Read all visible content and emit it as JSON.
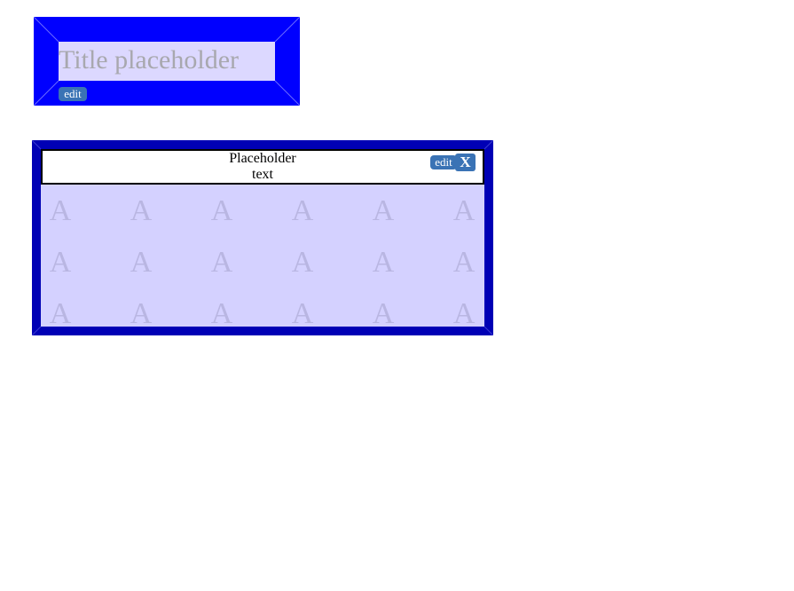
{
  "title_widget": {
    "placeholder": "Title placeholder",
    "edit_label": "edit"
  },
  "text_block": {
    "text_line_1": "Placeholder",
    "text_line_2": "text",
    "edit_label": "edit",
    "close_label": "X",
    "background_glyph": "A"
  },
  "colors": {
    "title_frame": "#0000ff",
    "block_frame": "#0000b5",
    "input_fill": "#dcd8ff",
    "body_fill": "#d4d1ff",
    "button": "#3a73b5"
  },
  "icons": {
    "close": "close-icon"
  }
}
